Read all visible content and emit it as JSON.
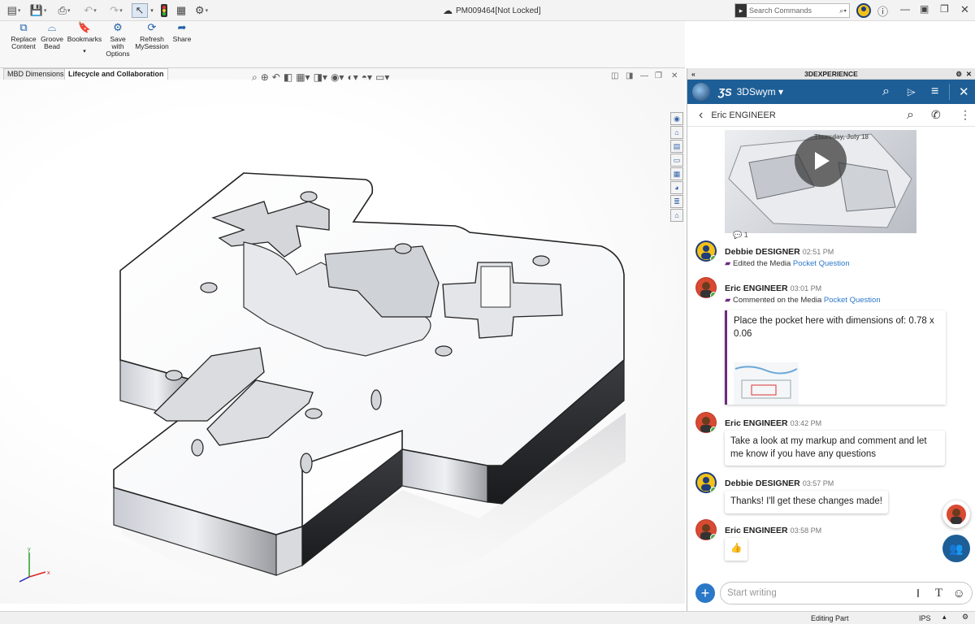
{
  "titlebar": {
    "document_title": "PM009464[Not Locked]",
    "search_placeholder": "Search Commands"
  },
  "ribbon": {
    "buttons": [
      {
        "label": "Replace Content",
        "line1": "Replace",
        "line2": "Content",
        "line3": ""
      },
      {
        "label": "Groove Bead",
        "line1": "Groove",
        "line2": "Bead",
        "line3": ""
      },
      {
        "label": "Bookmarks",
        "line1": "Bookmarks",
        "line2": "",
        "line3": ""
      },
      {
        "label": "Save with Options",
        "line1": "Save",
        "line2": "with",
        "line3": "Options"
      },
      {
        "label": "Refresh MySession",
        "line1": "Refresh",
        "line2": "MySession",
        "line3": ""
      },
      {
        "label": "Share",
        "line1": "Share",
        "line2": "",
        "line3": ""
      }
    ]
  },
  "tabs": {
    "mbd": "MBD Dimensions",
    "lifecycle": "Lifecycle and Collaboration"
  },
  "triad": {
    "x": "x",
    "y": "y"
  },
  "status": {
    "editing": "Editing Part",
    "units": "IPS"
  },
  "panel": {
    "header_title": "3DEXPERIENCE",
    "app_name": "3DSwym",
    "conversation_title": "Eric ENGINEER",
    "composer_placeholder": "Start writing",
    "video": {
      "date_label": "Thursday, July 18",
      "comment_count": "1"
    }
  },
  "messages": [
    {
      "author": "Debbie DESIGNER",
      "time": "02:51 PM",
      "activity_prefix": "Edited the Media",
      "link": "Pocket Question",
      "avatar": "debbie"
    },
    {
      "author": "Eric ENGINEER",
      "time": "03:01 PM",
      "activity_prefix": "Commented on the Media",
      "link": "Pocket Question",
      "comment_text": "Place the pocket here with dimensions of:  0.78 x 0.06",
      "avatar": "eric"
    },
    {
      "author": "Eric ENGINEER",
      "time": "03:42 PM",
      "text": "Take a look at my markup and comment and let me know if you have any questions",
      "avatar": "eric"
    },
    {
      "author": "Debbie DESIGNER",
      "time": "03:57 PM",
      "text": "Thanks!  I'll get these changes made!",
      "avatar": "debbie"
    },
    {
      "author": "Eric ENGINEER",
      "time": "03:58 PM",
      "text": "👍",
      "avatar": "eric"
    }
  ],
  "icons": {
    "new_doc": "new-document-icon",
    "save": "save-icon",
    "print": "print-icon",
    "undo": "undo-icon",
    "redo": "redo-icon",
    "select": "select-icon",
    "traffic": "rebuild-icon",
    "options": "options-icon",
    "help": "help-icon",
    "user": "user-compass-icon",
    "search": "search-icon",
    "tag": "tag-icon",
    "menu": "hamburger-menu-icon",
    "close": "close-icon",
    "back": "back-chevron-icon",
    "phone": "phone-icon",
    "more": "more-vertical-icon",
    "add": "add-icon",
    "text_format": "text-format-icon",
    "emoji": "emoji-icon",
    "community": "community-icon",
    "play": "play-icon"
  },
  "colors": {
    "swym_blue": "#1d5e96",
    "link_blue": "#2a78c8",
    "comment_border": "#6e2b7e",
    "online_green": "#49a942",
    "add_button": "#2a78c8"
  }
}
